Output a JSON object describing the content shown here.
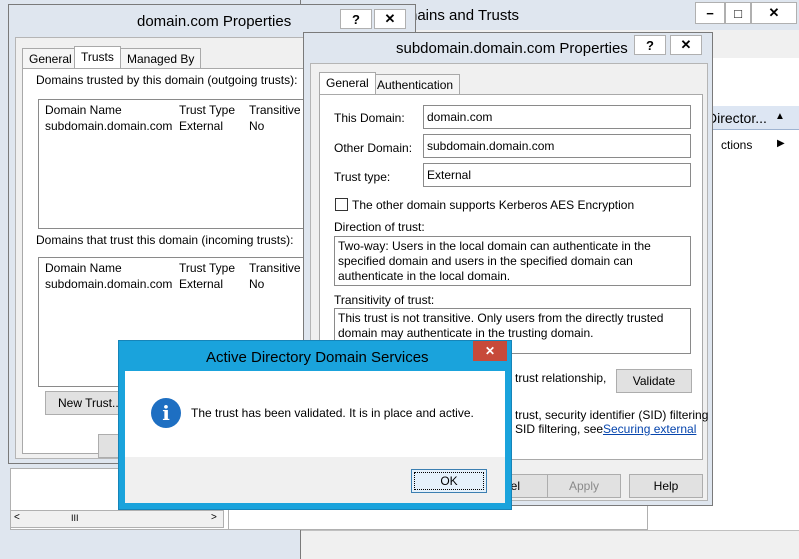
{
  "bg_window": {
    "title_partial": "nains and Trusts",
    "action_header": "Director...",
    "action_item": "ctions",
    "min": "−",
    "max": "□",
    "close": "✕",
    "scroll_thumb": "III"
  },
  "domain_props": {
    "title": "domain.com Properties",
    "help": "?",
    "close": "✕",
    "tabs": [
      "General",
      "Trusts",
      "Managed By"
    ],
    "outgoing_label": "Domains trusted by this domain (outgoing trusts):",
    "incoming_label": "Domains that trust this domain (incoming trusts):",
    "columns": [
      "Domain Name",
      "Trust Type",
      "Transitive"
    ],
    "outgoing_rows": [
      [
        "subdomain.domain.com",
        "External",
        "No"
      ]
    ],
    "incoming_rows": [
      [
        "subdomain.domain.com",
        "External",
        "No"
      ]
    ],
    "new_trust": "New Trust..."
  },
  "sub_props": {
    "title": "subdomain.domain.com Properties",
    "help": "?",
    "close": "✕",
    "tabs": [
      "General",
      "Authentication"
    ],
    "this_domain_label": "This Domain:",
    "this_domain_value": "domain.com",
    "other_domain_label": "Other Domain:",
    "other_domain_value": "subdomain.domain.com",
    "trust_type_label": "Trust type:",
    "trust_type_value": "External",
    "kerberos_label": "The other domain supports Kerberos AES Encryption",
    "direction_label": "Direction of trust:",
    "direction_text": "Two-way: Users in the local domain can authenticate in the specified domain and users in the specified domain can authenticate in the local domain.",
    "transitivity_label": "Transitivity of trust:",
    "transitivity_text": "This trust is not transitive. Only users from the directly trusted domain may authenticate in the trusting domain.",
    "validate_text": "trust relationship,",
    "validate_btn": "Validate",
    "sid_line1": "trust, security identifier (SID) filtering",
    "sid_line2": "SID filtering, see",
    "sid_link": "Securing external",
    "cancel_partial": "el",
    "apply": "Apply",
    "help_btn": "Help"
  },
  "dialog": {
    "title": "Active Directory Domain Services",
    "close": "✕",
    "message": "The trust has been validated. It is in place and active.",
    "icon_glyph": "i",
    "ok": "OK"
  }
}
